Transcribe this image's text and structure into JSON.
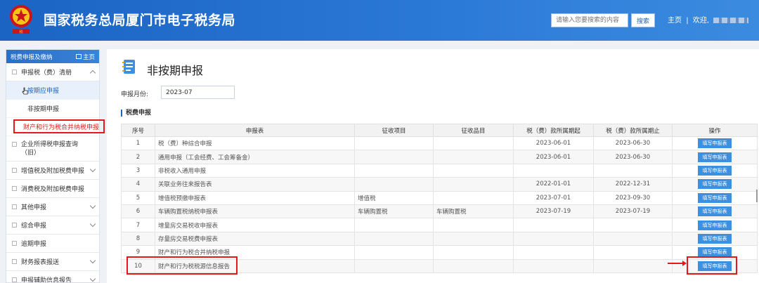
{
  "header": {
    "title": "国家税务总局厦门市电子税务局",
    "search_placeholder": "请输入您要搜索的内容",
    "search_button": "搜索",
    "home_link": "主页",
    "welcome": "欢迎,"
  },
  "sidebar": {
    "header_label": "税费申报及缴纳",
    "home_label": "主页",
    "items": [
      {
        "label": "申报税（费）清册"
      },
      {
        "label": "按期应申报"
      },
      {
        "label": "非按期申报"
      },
      {
        "label": "财产和行为税合并纳税申报"
      },
      {
        "label": "企业所得税申报查询（旧）"
      },
      {
        "label": "增值税及附加税费申报"
      },
      {
        "label": "消费税及附加税费申报"
      },
      {
        "label": "其他申报"
      },
      {
        "label": "综合申报"
      },
      {
        "label": "逾期申报"
      },
      {
        "label": "财务报表报送"
      },
      {
        "label": "申报辅助信息报告"
      }
    ]
  },
  "main": {
    "page_title": "非按期申报",
    "month_label": "申报月份:",
    "month_value": "2023-07",
    "section_title": "税费申报",
    "columns": [
      "序号",
      "申报表",
      "征收项目",
      "征收品目",
      "税（费）款所属期起",
      "税（费）款所属期止",
      "操作"
    ],
    "action_label": "填写申报表",
    "rows": [
      {
        "no": "1",
        "form": "税（费）种综合申报",
        "item": "",
        "sub": "",
        "start": "2023-06-01",
        "end": "2023-06-30"
      },
      {
        "no": "2",
        "form": "通用申报（工会经费、工会筹备金）",
        "item": "",
        "sub": "",
        "start": "2023-06-01",
        "end": "2023-06-30"
      },
      {
        "no": "3",
        "form": "非税收入通用申报",
        "item": "",
        "sub": "",
        "start": "",
        "end": ""
      },
      {
        "no": "4",
        "form": "关联业务往来报告表",
        "item": "",
        "sub": "",
        "start": "2022-01-01",
        "end": "2022-12-31"
      },
      {
        "no": "5",
        "form": "增值税预缴申报表",
        "item": "增值税",
        "sub": "",
        "start": "2023-07-01",
        "end": "2023-09-30"
      },
      {
        "no": "6",
        "form": "车辆购置税纳税申报表",
        "item": "车辆购置税",
        "sub": "车辆购置税",
        "start": "2023-07-19",
        "end": "2023-07-19"
      },
      {
        "no": "7",
        "form": "增量房交易税收申报表",
        "item": "",
        "sub": "",
        "start": "",
        "end": ""
      },
      {
        "no": "8",
        "form": "存量房交易税费申报表",
        "item": "",
        "sub": "",
        "start": "",
        "end": ""
      },
      {
        "no": "9",
        "form": "财产和行为税合并纳税申报",
        "item": "",
        "sub": "",
        "start": "",
        "end": ""
      },
      {
        "no": "10",
        "form": "财产和行为税税源信息报告",
        "item": "",
        "sub": "",
        "start": "",
        "end": ""
      }
    ]
  },
  "colors": {
    "header_blue": "#1b64c4",
    "button_blue": "#3d8fe0",
    "highlight_red": "#e3191a"
  }
}
